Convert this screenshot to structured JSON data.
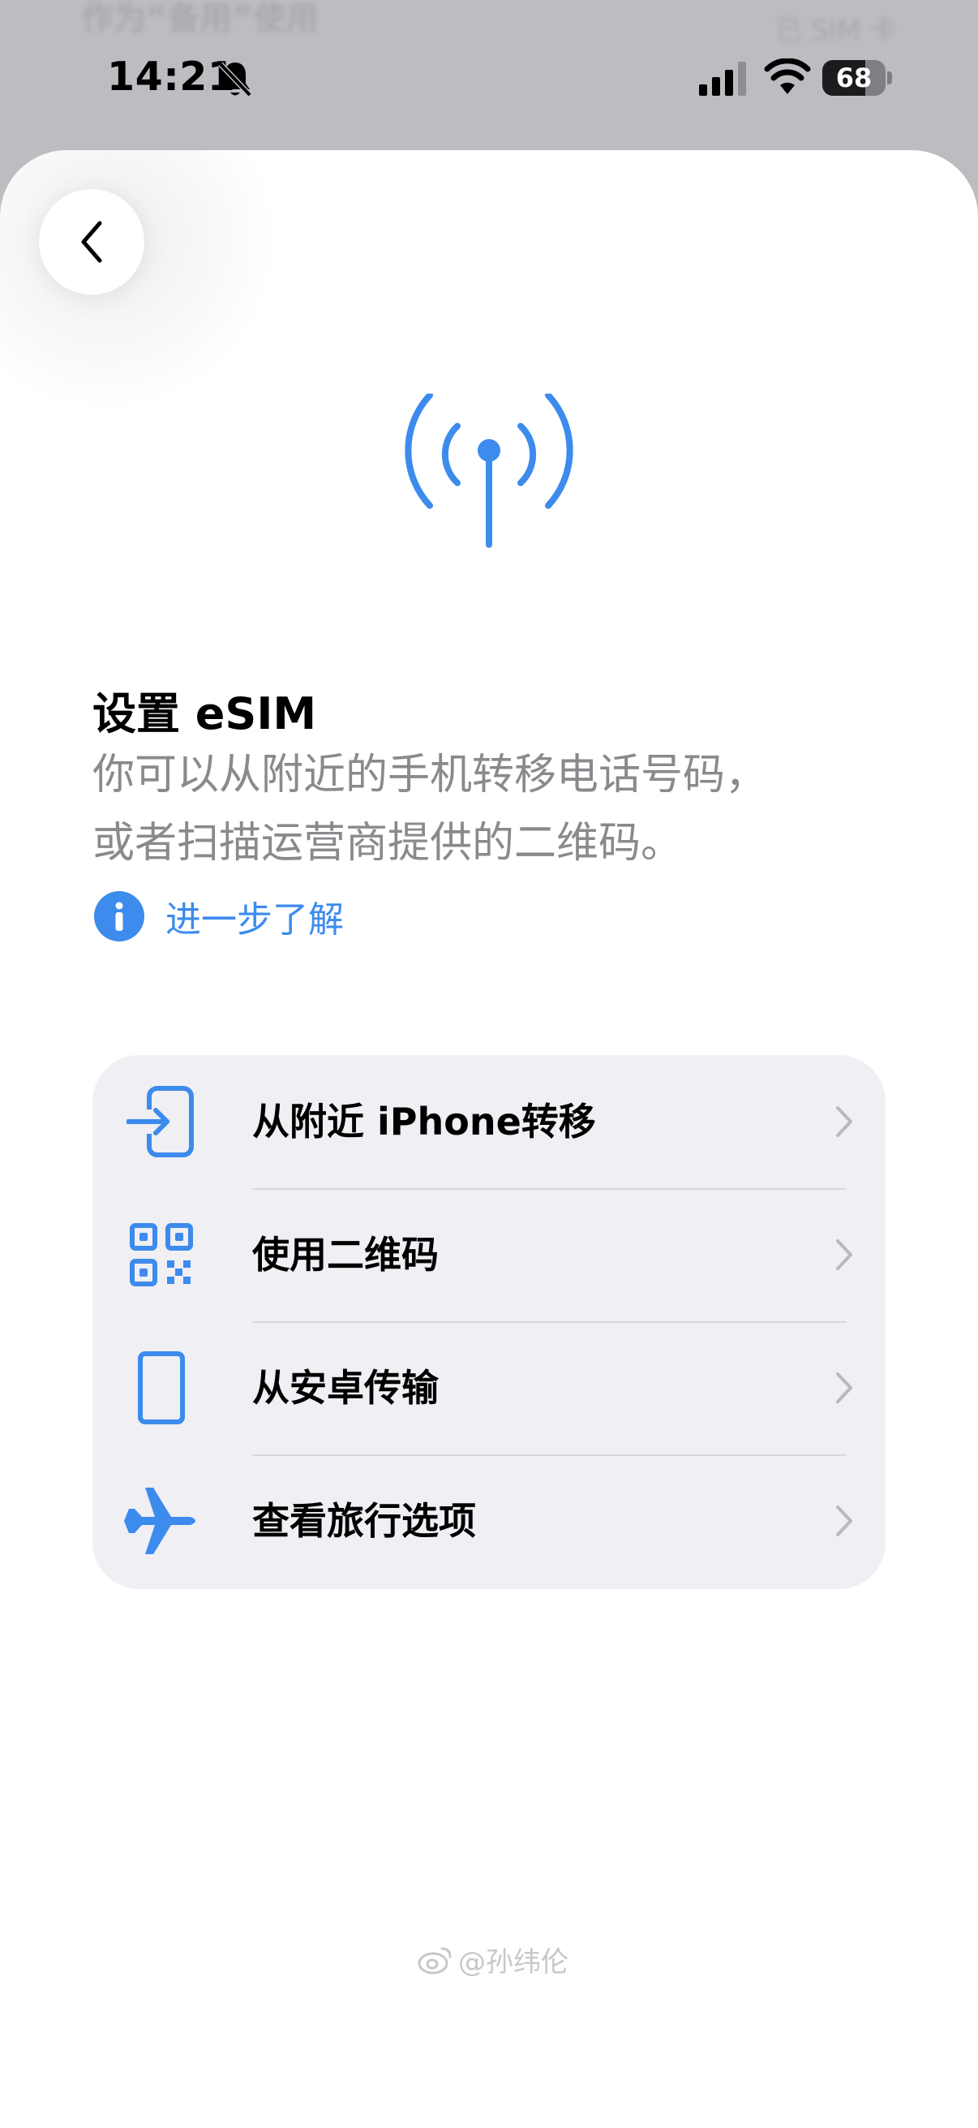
{
  "status_bar": {
    "time": "14:21",
    "battery_level": "68",
    "battery_fraction": 0.68,
    "icons": [
      "bell-slash-icon",
      "cellular-signal-icon",
      "wifi-icon",
      "battery-icon"
    ]
  },
  "background_page": {
    "text_left": "作为“备用”使用",
    "text_right": "已 SIM 卡"
  },
  "header": {
    "back_icon": "chevron-left-icon",
    "hero_icon": "antenna-icon"
  },
  "content": {
    "title": "设置 eSIM",
    "description": "你可以从附近的手机转移电话号码，\n或者扫描运营商提供的二维码。",
    "learn_more": "进一步了解"
  },
  "options": [
    {
      "label": "从附近 iPhone转移",
      "icon": "phone-transfer-icon"
    },
    {
      "label": "使用二维码",
      "icon": "qr-code-icon"
    },
    {
      "label": "从安卓传输",
      "icon": "android-phone-icon"
    },
    {
      "label": "查看旅行选项",
      "icon": "airplane-icon"
    }
  ],
  "colors": {
    "accent": "#3c8bed",
    "list_background": "#efeff4",
    "secondary_text": "#8a8a8e"
  },
  "watermark": {
    "text": "@孙纬伦"
  }
}
